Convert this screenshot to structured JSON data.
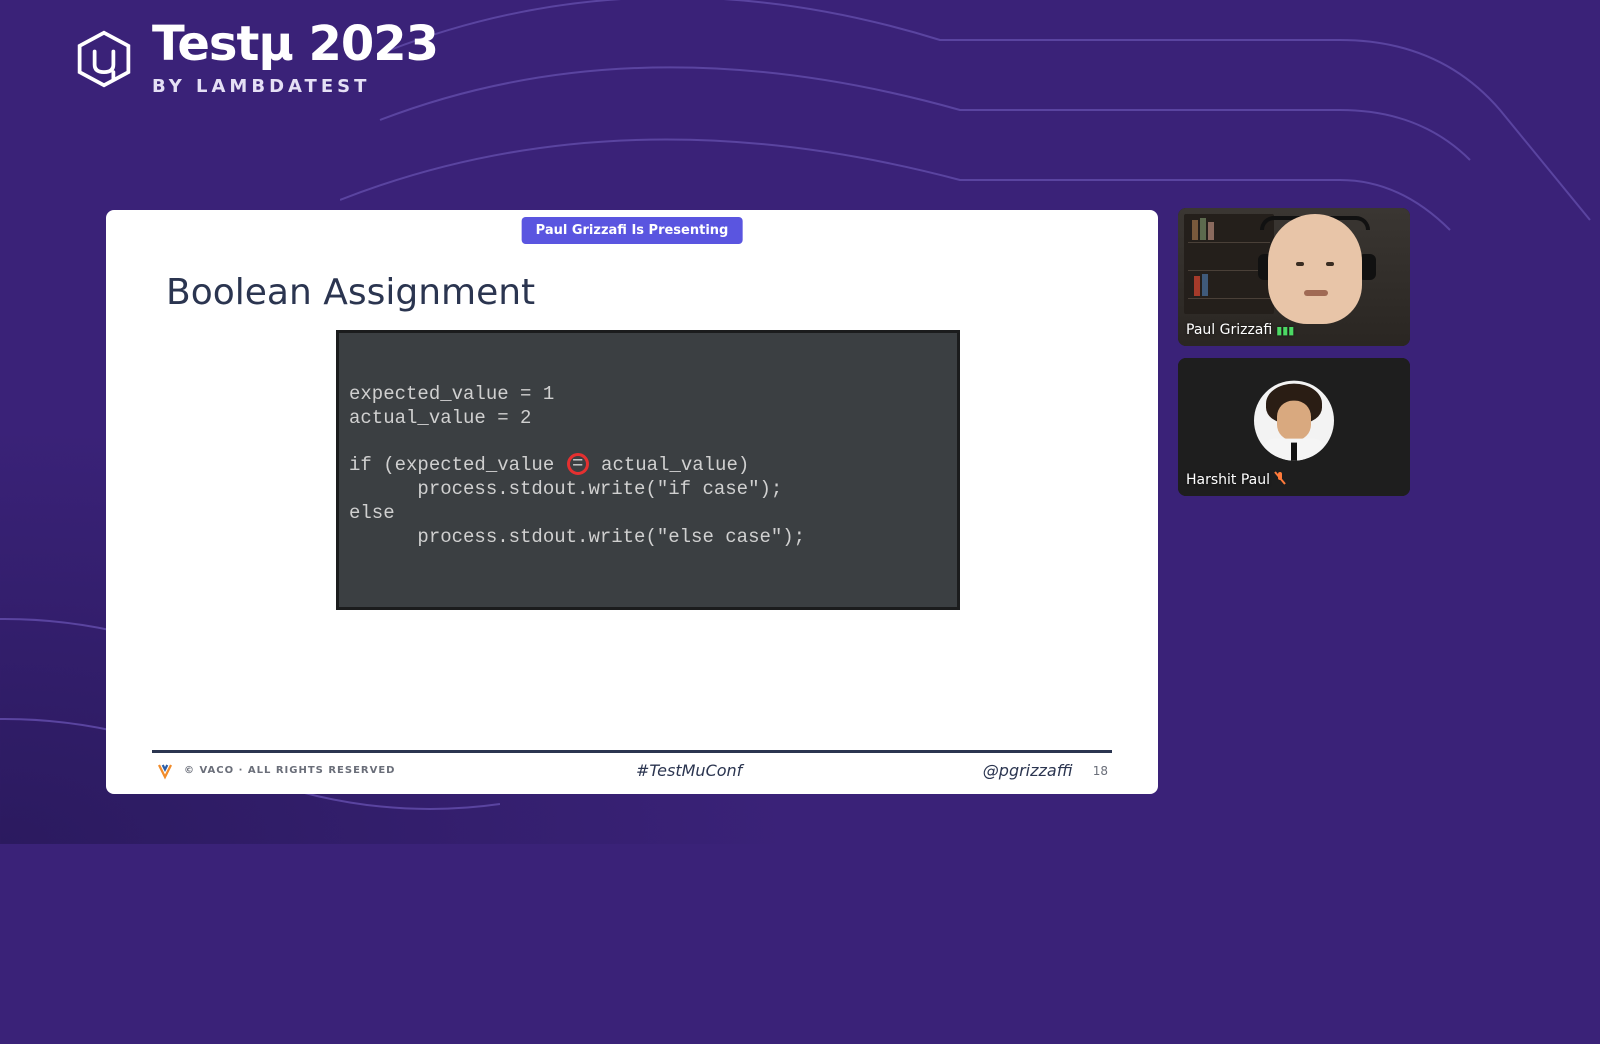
{
  "brand": {
    "title": "Testμ 2023",
    "subtitle": "BY LAMBDATEST"
  },
  "presenting_badge": "Paul Grizzafi Is Presenting",
  "slide": {
    "title": "Boolean Assignment",
    "code": {
      "line1": "expected_value = 1",
      "line2": "actual_value = 2",
      "line3a": "if (expected_value ",
      "line3_highlight": "=",
      "line3b": " actual_value)",
      "line4": "      process.stdout.write(\"if case\");",
      "line5": "else",
      "line6": "      process.stdout.write(\"else case\");"
    },
    "footer": {
      "left": "© VACO · ALL RIGHTS RESERVED",
      "center": "#TestMuConf",
      "right": "@pgrizzaffi",
      "page": "18"
    }
  },
  "participants": {
    "presenter": {
      "name": "Paul Grizzafi"
    },
    "other": {
      "name": "Harshit Paul"
    }
  }
}
